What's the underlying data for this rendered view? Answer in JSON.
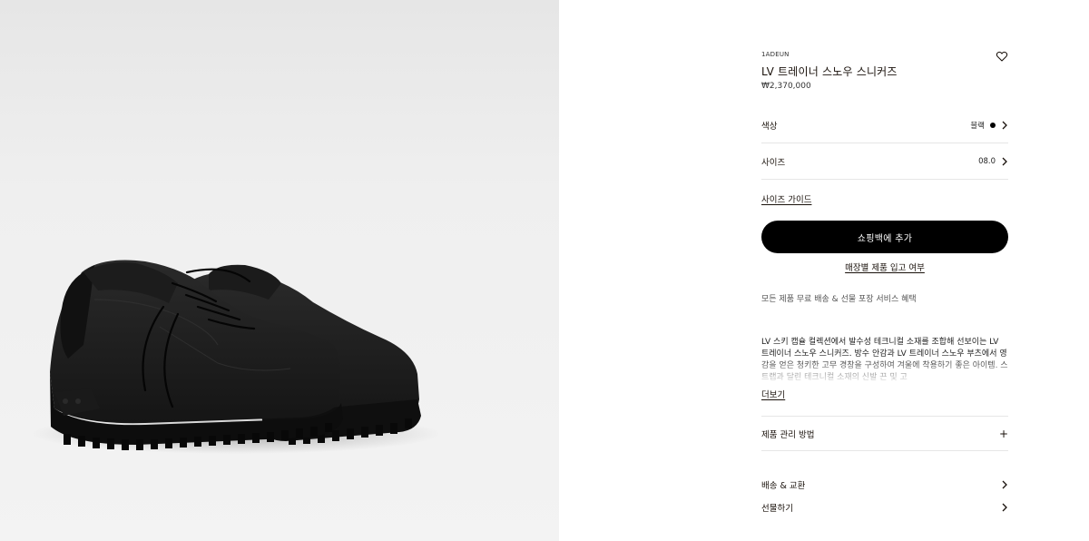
{
  "product": {
    "sku": "1ADEUN",
    "name": "LV 트레이너 스노우 스니커즈",
    "price": "₩2,370,000"
  },
  "options": {
    "color_label": "색상",
    "color_value": "블랙",
    "size_label": "사이즈",
    "size_value": "08.0",
    "size_guide": "사이즈 가이드"
  },
  "actions": {
    "add_to_bag": "쇼핑백에 추가",
    "store_stock": "매장별 제품 입고 여부"
  },
  "benefit": "모든 제품 무료 배송 & 선물 포장 서비스 혜택",
  "description": {
    "text": "LV 스키 캡슐 컬렉션에서 발수성 테크니컬 소재를 조합해 선보이는 LV 트레이너 스노우 스니커즈. 방수 안감과 LV 트레이너 스노우 부츠에서 영감을 얻은 청키한 고무 경창을 구성하여 겨울에 착용하기 좋은 아이템. 스트랩과 달린 테크니컬 소재의 신발 끈 및 고",
    "more": "더보기"
  },
  "care": {
    "label": "제품 관리 방법",
    "icon": "plus-icon"
  },
  "links": [
    {
      "label": "배송 & 교환"
    },
    {
      "label": "선물하기"
    }
  ],
  "colors": {
    "accent": "#000000",
    "text": "#19110b",
    "divider": "#e6e6e6"
  }
}
